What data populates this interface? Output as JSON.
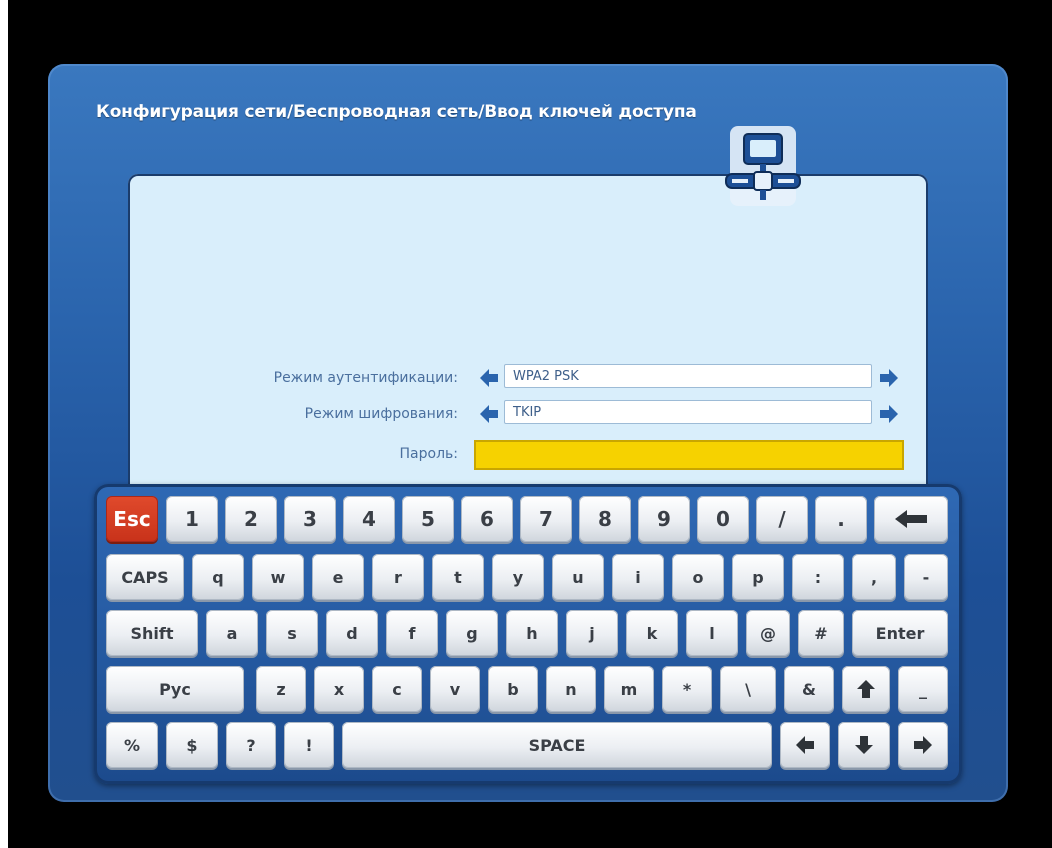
{
  "breadcrumb": "Конфигурация сети/Беспроводная сеть/Ввод ключей доступа",
  "form": {
    "auth_label": "Режим аутентификации:",
    "auth_value": "WPA2 PSK",
    "enc_label": "Режим шифрования:",
    "enc_value": "TKIP",
    "password_label": "Пароль:",
    "password_value": ""
  },
  "keyboard": {
    "row1": [
      "Esc",
      "1",
      "2",
      "3",
      "4",
      "5",
      "6",
      "7",
      "8",
      "9",
      "0",
      "/",
      "."
    ],
    "row2": [
      "CAPS",
      "q",
      "w",
      "e",
      "r",
      "t",
      "y",
      "u",
      "i",
      "o",
      "p",
      ":",
      ",",
      "-"
    ],
    "row3": [
      "Shift",
      "a",
      "s",
      "d",
      "f",
      "g",
      "h",
      "j",
      "k",
      "l",
      "@",
      "#",
      "Enter"
    ],
    "row4": [
      "Рус",
      "z",
      "x",
      "c",
      "v",
      "b",
      "n",
      "m",
      "*",
      "\\",
      "&",
      "_"
    ],
    "row5": [
      "%",
      "$",
      "?",
      "!",
      "SPACE"
    ],
    "icons": {
      "backspace": "backspace-arrow-icon",
      "up": "arrow-up-icon",
      "left": "arrow-left-icon",
      "down": "arrow-down-icon",
      "right": "arrow-right-icon"
    }
  },
  "colors": {
    "dialog": "#2a64ad",
    "panel": "#d9eefb",
    "password_highlight": "#f6d200",
    "esc_key": "#c8321a",
    "arrow": "#2a64ad"
  }
}
